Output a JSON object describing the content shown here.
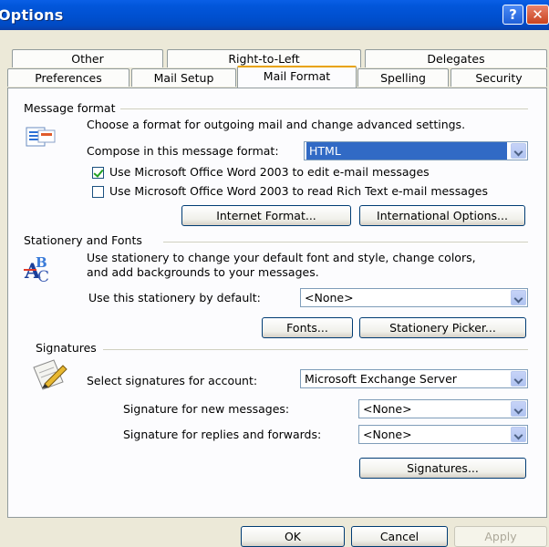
{
  "window": {
    "title": "Options"
  },
  "tabs_top": [
    "Other",
    "Right-to-Left",
    "Delegates"
  ],
  "tabs_bottom": [
    "Preferences",
    "Mail Setup",
    "Mail Format",
    "Spelling",
    "Security"
  ],
  "message_format": {
    "title": "Message format",
    "description": "Choose a format for outgoing mail and change advanced settings.",
    "compose_label": "Compose in this message format:",
    "compose_value": "HTML",
    "use_word_edit_label": "Use Microsoft Office Word 2003 to edit e-mail messages",
    "use_word_edit_checked": true,
    "use_word_read_label": "Use Microsoft Office Word 2003 to read Rich Text e-mail messages",
    "use_word_read_checked": false,
    "internet_format_label": "Internet Format...",
    "international_options_label": "International Options..."
  },
  "stationery": {
    "title": "Stationery and Fonts",
    "description_line1": "Use stationery to change your default font and style, change colors,",
    "description_line2": "and add backgrounds to your messages.",
    "default_label": "Use this stationery by default:",
    "default_value": "<None>",
    "fonts_label": "Fonts...",
    "picker_label": "Stationery Picker..."
  },
  "signatures": {
    "title": "Signatures",
    "account_label": "Select signatures for account:",
    "account_value": "Microsoft Exchange Server",
    "new_label": "Signature for new messages:",
    "new_value": "<None>",
    "replies_label": "Signature for replies and forwards:",
    "replies_value": "<None>",
    "signatures_button_label": "Signatures..."
  },
  "footer": {
    "ok_label": "OK",
    "cancel_label": "Cancel",
    "apply_label": "Apply"
  },
  "colors": {
    "titlebar": "#0054e3",
    "selection": "#316ac5",
    "dialog_bg": "#ece9d8",
    "active_tab_accent": "#e9a300"
  }
}
